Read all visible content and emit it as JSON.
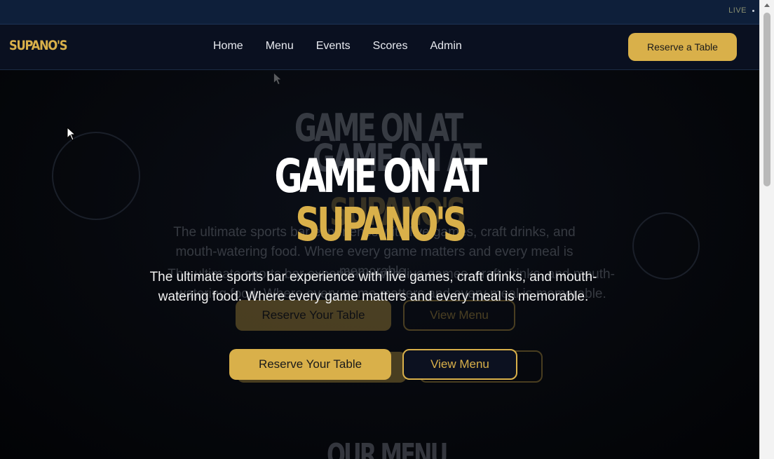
{
  "topbar": {
    "status": "LIVE"
  },
  "nav": {
    "logo": "SUPANO'S",
    "links": [
      "Home",
      "Menu",
      "Events",
      "Scores",
      "Admin"
    ],
    "cta": "Reserve a Table"
  },
  "hero": {
    "title_line1": "GAME ON AT",
    "title_line2": "SUPANO'S",
    "subtitle": "The ultimate sports bar experience with live games, craft drinks, and mouth-watering food. Where every game matters and every meal is memorable.",
    "primary_button": "Reserve Your Table",
    "secondary_button": "View Menu"
  },
  "next_section": {
    "title": "OUR MENU"
  },
  "colors": {
    "accent": "#d9b04a",
    "topbar": "#0e1f3a",
    "navbar": "#0a1020",
    "background": "#05070c"
  }
}
